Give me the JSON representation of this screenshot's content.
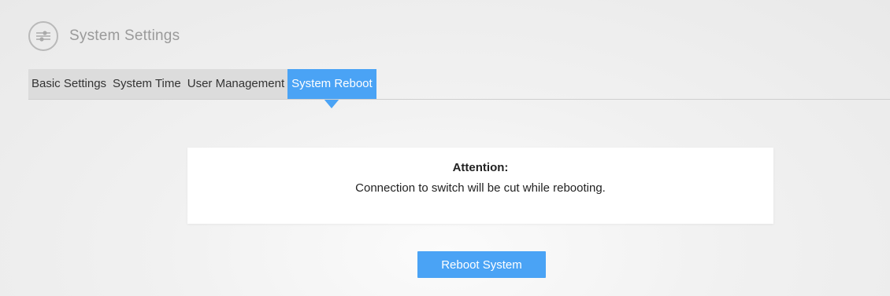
{
  "header": {
    "title": "System Settings",
    "icon": "settings-sliders-icon"
  },
  "tabs": [
    {
      "label": "Basic Settings",
      "active": false
    },
    {
      "label": "System Time",
      "active": false
    },
    {
      "label": "User Management",
      "active": false
    },
    {
      "label": "System Reboot",
      "active": true
    }
  ],
  "notice": {
    "title": "Attention:",
    "message": "Connection to switch will be cut while rebooting."
  },
  "actions": {
    "reboot_label": "Reboot System"
  },
  "colors": {
    "accent": "#4aa3f5",
    "tab_inactive_bg": "#dcdcdc",
    "header_text": "#9a9a9a"
  }
}
